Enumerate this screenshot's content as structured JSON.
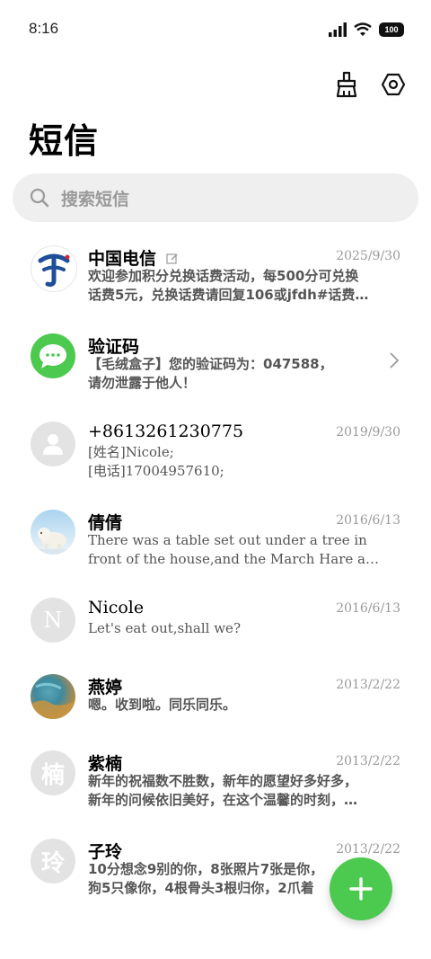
{
  "status_bar": {
    "time": "8:16",
    "battery": "100"
  },
  "header": {
    "title": "短信"
  },
  "search": {
    "placeholder": "搜索短信"
  },
  "conversations": [
    {
      "name": "中国电信",
      "date": "2025/9/30",
      "preview_line1": "欢迎参加积分兑换话费活动，每500分可兑换",
      "preview_line2": "话费5元，兑换话费请回复106或jfdh#话费…",
      "avatar": "china-telecom-logo"
    },
    {
      "name": "验证码",
      "date": "",
      "preview_line1": "【毛绒盒子】您的验证码为：047588，",
      "preview_line2": "请勿泄露于他人！",
      "avatar": "message-bubble-icon"
    },
    {
      "name": "+8613261230775",
      "date": "2019/9/30",
      "preview_line1": "[姓名]Nicole;",
      "preview_line2": "[电话]17004957610;",
      "avatar": "person-icon"
    },
    {
      "name": "倩倩",
      "date": "2016/6/13",
      "preview_line1": "There was a table set out under a tree in",
      "preview_line2": "front of the house,and the March Hare a…",
      "avatar": "polar-bear-photo"
    },
    {
      "name": "Nicole",
      "date": "2016/6/13",
      "preview_line1": "Let's eat out,shall we?",
      "preview_line2": "",
      "avatar_letter": "N"
    },
    {
      "name": "燕婷",
      "date": "2013/2/22",
      "preview_line1": "嗯。收到啦。同乐同乐。",
      "preview_line2": "",
      "avatar": "landscape-photo"
    },
    {
      "name": "紫楠",
      "date": "2013/2/22",
      "preview_line1": "新年的祝福数不胜数，新年的愿望好多好多，",
      "preview_line2": "新年的问候依旧美好，在这个温馨的时刻，…",
      "avatar_letter": "楠"
    },
    {
      "name": "子玲",
      "date": "2013/2/22",
      "preview_line1": "10分想念9别的你，8张照片7张是你，",
      "preview_line2": "狗5只像你，4根骨头3根归你，2爪着",
      "avatar_letter": "玲"
    }
  ],
  "colors": {
    "accent": "#4cc94f",
    "muted": "#9a9a9a",
    "avatar_gray": "#e3e3e3",
    "telecom_blue": "#1f4e9b"
  }
}
